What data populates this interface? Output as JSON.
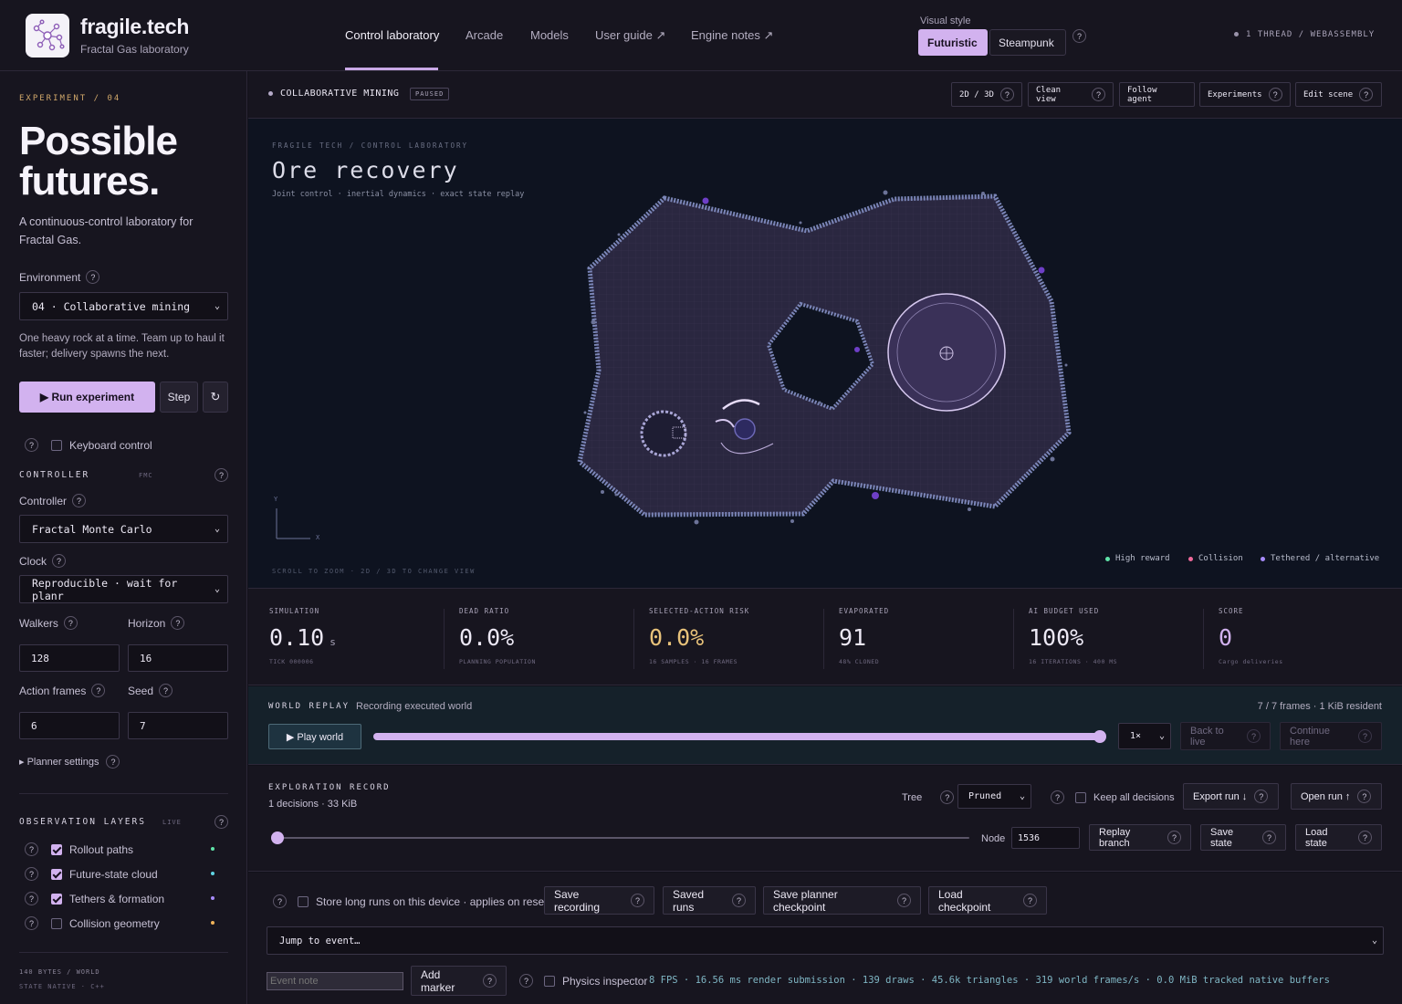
{
  "brand": {
    "title": "fragile.tech",
    "subtitle": "Fractal Gas laboratory"
  },
  "nav": [
    {
      "label": "Control laboratory"
    },
    {
      "label": "Arcade"
    },
    {
      "label": "Models"
    },
    {
      "label": "User guide ↗"
    },
    {
      "label": "Engine notes ↗"
    }
  ],
  "visual_style": {
    "label": "Visual style",
    "options": [
      "Futuristic",
      "Steampunk"
    ],
    "selected": "Futuristic"
  },
  "thread_status": "1 THREAD / WEBASSEMBLY",
  "sidebar": {
    "experiment_label": "EXPERIMENT / 04",
    "hero": "Possible futures.",
    "hero_sub": "A continuous-control laboratory for Fractal Gas.",
    "environment_label": "Environment",
    "environment_value": "04 · Collaborative mining",
    "environment_desc": "One heavy rock at a time. Team up to haul it faster; delivery spawns the next.",
    "run_label": "▶ Run experiment",
    "step_label": "Step",
    "reset_icon": "↻",
    "keyboard_label": "Keyboard control",
    "controller_section": "CONTROLLER",
    "controller_section_sub": "FMC",
    "controller_label": "Controller",
    "controller_value": "Fractal Monte Carlo",
    "clock_label": "Clock",
    "clock_value": "Reproducible · wait for planr",
    "walkers_label": "Walkers",
    "walkers_value": "128",
    "horizon_label": "Horizon",
    "horizon_value": "16",
    "action_frames_label": "Action frames",
    "action_frames_value": "6",
    "seed_label": "Seed",
    "seed_value": "7",
    "planner_settings": "▸ Planner settings",
    "obs_section": "OBSERVATION LAYERS",
    "obs_section_sub": "LIVE",
    "layers": [
      {
        "label": "Rollout paths",
        "checked": true,
        "color": "#5fe3a8"
      },
      {
        "label": "Future-state cloud",
        "checked": true,
        "color": "#5fd4e3"
      },
      {
        "label": "Tethers & formation",
        "checked": true,
        "color": "#a78bfa"
      },
      {
        "label": "Collision geometry",
        "checked": false,
        "color": "#f0b35a"
      }
    ],
    "footer_1": "140 BYTES / WORLD",
    "footer_2": "STATE NATIVE · C++"
  },
  "scene": {
    "title": "COLLABORATIVE MINING",
    "status": "PAUSED",
    "buttons": [
      "2D / 3D",
      "Clean view",
      "Follow agent",
      "Experiments",
      "Edit scene"
    ]
  },
  "canvas": {
    "crumb": "FRAGILE TECH / CONTROL LABORATORY",
    "title": "Ore recovery",
    "subtitle": "Joint control · inertial dynamics · exact state replay",
    "hint": "SCROLL TO ZOOM · 2D / 3D TO CHANGE VIEW",
    "axis_y": "Y",
    "axis_x": "X",
    "legend": [
      {
        "label": "High reward",
        "color": "#5fe3a8"
      },
      {
        "label": "Collision",
        "color": "#f0699a"
      },
      {
        "label": "Tethered / alternative",
        "color": "#a78bfa"
      }
    ]
  },
  "stats": [
    {
      "key": "SIMULATION",
      "value": "0.10",
      "unit": "s",
      "sub": "TICK 000006",
      "color": "#ece8f4"
    },
    {
      "key": "DEAD RATIO",
      "value": "0.0%",
      "unit": "",
      "sub": "PLANNING POPULATION",
      "color": "#ece8f4"
    },
    {
      "key": "SELECTED-ACTION RISK",
      "value": "0.0%",
      "unit": "",
      "sub": "16 SAMPLES · 16 FRAMES",
      "color": "#e8c27a"
    },
    {
      "key": "EVAPORATED",
      "value": "91",
      "unit": "",
      "sub": "48% CLONED",
      "color": "#ece8f4"
    },
    {
      "key": "AI BUDGET USED",
      "value": "100%",
      "unit": "",
      "sub": "16 ITERATIONS · 400 MS",
      "color": "#ece8f4"
    },
    {
      "key": "SCORE",
      "value": "0",
      "unit": "",
      "sub": "Cargo deliveries",
      "color": "#d2b2ef"
    }
  ],
  "replay": {
    "title": "WORLD REPLAY",
    "status": "Recording executed world",
    "frames": "7 / 7 frames · 1 KiB resident",
    "play_label": "▶ Play world",
    "progress": 1.0,
    "speed": "1×",
    "back_label": "Back to live",
    "continue_label": "Continue here"
  },
  "exploration": {
    "title": "EXPLORATION RECORD",
    "sub": "1 decisions · 33 KiB",
    "tree_label": "Tree",
    "tree_value": "Pruned",
    "keep_label": "Keep all decisions",
    "export_label": "Export run ↓",
    "open_label": "Open run ↑",
    "node_label": "Node",
    "node_value": "1536",
    "node_progress": 0.0,
    "replay_branch": "Replay branch",
    "save_state": "Save state",
    "load_state": "Load state"
  },
  "bottom": {
    "store_label": "Store long runs on this device · applies on reset",
    "save_recording": "Save recording",
    "saved_runs": "Saved runs",
    "save_checkpoint": "Save planner checkpoint",
    "load_checkpoint": "Load checkpoint",
    "jump_label": "Jump to event…",
    "note_placeholder": "Event note",
    "add_marker": "Add marker",
    "inspector_label": "Physics inspector",
    "perf": "8 FPS · 16.56 ms render submission · 139 draws · 45.6k triangles · 319 world frames/s · 0.0 MiB tracked native buffers"
  }
}
